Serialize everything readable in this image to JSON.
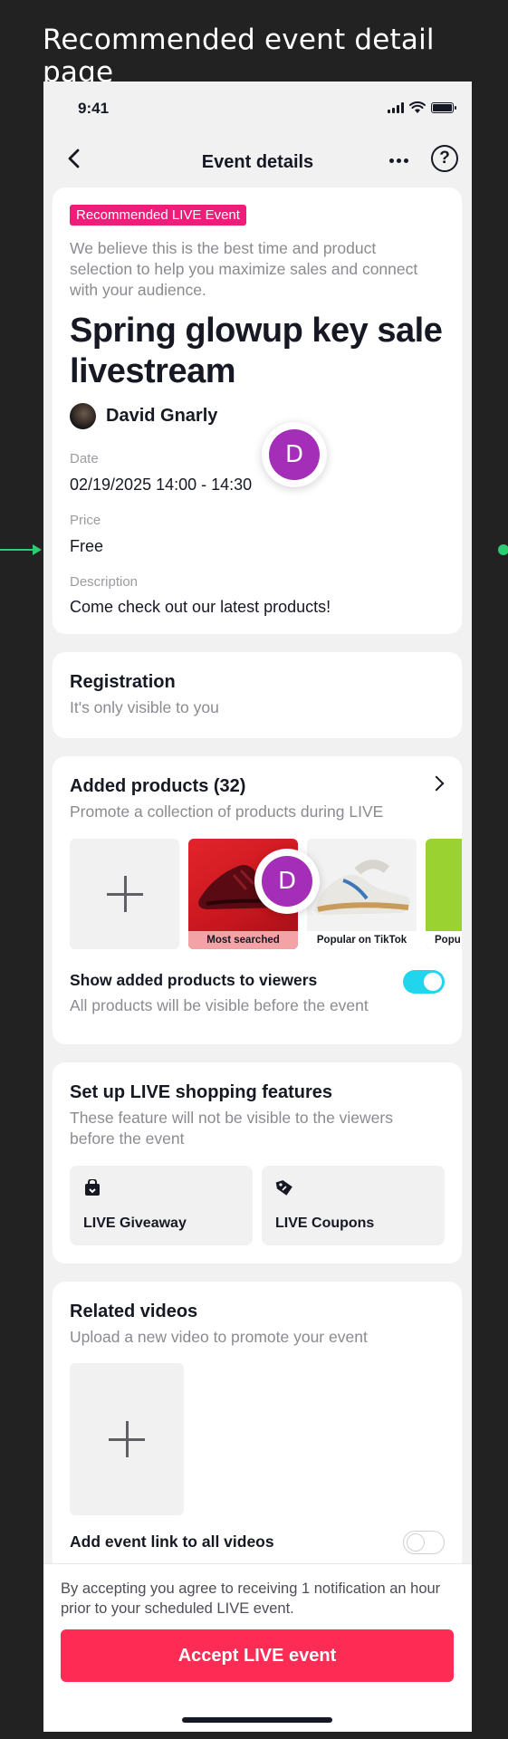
{
  "page_heading": "Recommended event detail page",
  "status_bar": {
    "time": "9:41"
  },
  "nav": {
    "title": "Event details",
    "help_glyph": "?"
  },
  "event": {
    "badge": "Recommended LIVE Event",
    "intro": "We believe this is the best time and product selection to help you maximize sales and connect with your audience.",
    "title": "Spring glowup key sale livestream",
    "host": "David Gnarly",
    "date_label": "Date",
    "date_value": "02/19/2025 14:00 - 14:30",
    "price_label": "Price",
    "price_value": "Free",
    "description_label": "Description",
    "description_value": "Come check out our latest products!"
  },
  "cursor_initial": "D",
  "registration": {
    "title": "Registration",
    "subtitle": "It's only visible to you"
  },
  "products": {
    "title": "Added products (32)",
    "subtitle": "Promote a collection of products during LIVE",
    "tags": [
      "Most searched",
      "Popular on TikTok",
      "Popu"
    ],
    "show_label": "Show added products to viewers",
    "show_sub": "All products will be visible before the event",
    "show_toggle_on": true
  },
  "features": {
    "title": "Set up LIVE shopping features",
    "subtitle": "These feature will not be visible to the viewers before the event",
    "items": [
      {
        "label": "LIVE Giveaway",
        "icon": "giveaway-bag-icon"
      },
      {
        "label": "LIVE Coupons",
        "icon": "coupon-tag-icon"
      }
    ]
  },
  "videos": {
    "title": "Related videos",
    "subtitle": "Upload a new video to promote your event",
    "link_label": "Add event link to all videos",
    "link_toggle_on": false
  },
  "footer": {
    "legal": "By accepting you agree to receiving 1 notification an hour prior to your scheduled LIVE event.",
    "accept": "Accept LIVE event"
  },
  "colors": {
    "accent": "#fe2c55",
    "badge": "#ee1d7a",
    "toggle_on": "#20d5ec",
    "cursor_avatar": "#a42eb8",
    "connector": "#2ecc71"
  }
}
